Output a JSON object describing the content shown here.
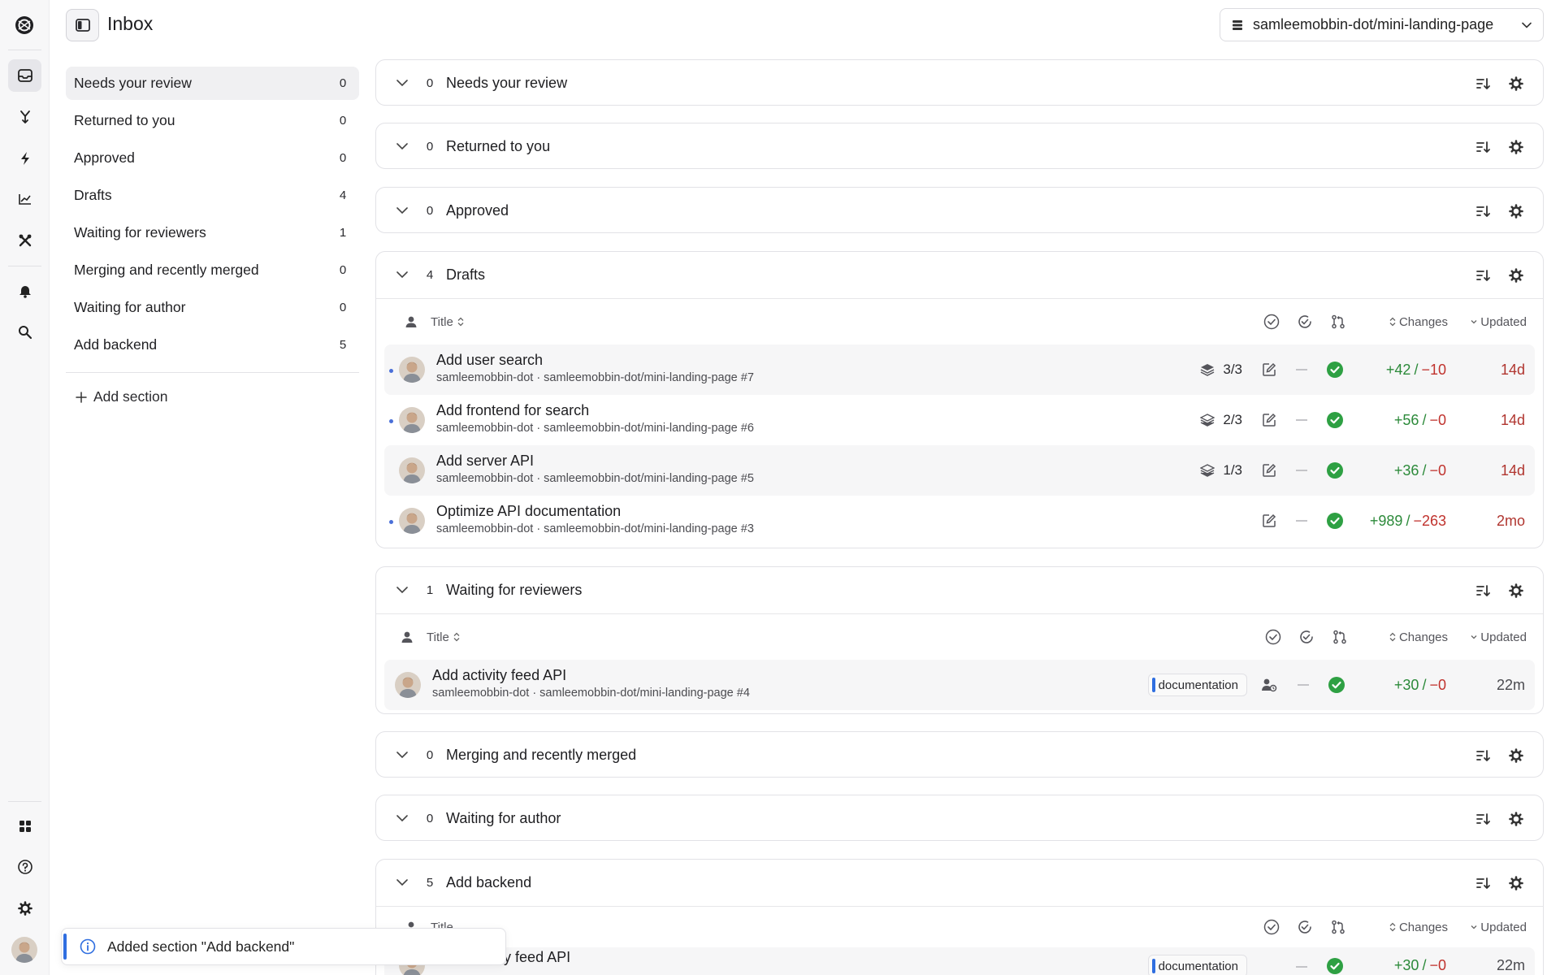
{
  "header": {
    "title": "Inbox",
    "repo": "samleemobbin-dot/mini-landing-page"
  },
  "colors": {
    "accent": "#2f6ee0",
    "additions": "#2c8a3a",
    "deletions": "#c0322d",
    "stale": "#b0352f",
    "check": "#2ea043"
  },
  "nav": {
    "items": [
      {
        "label": "Needs your review",
        "count": "0"
      },
      {
        "label": "Returned to you",
        "count": "0"
      },
      {
        "label": "Approved",
        "count": "0"
      },
      {
        "label": "Drafts",
        "count": "4"
      },
      {
        "label": "Waiting for reviewers",
        "count": "1"
      },
      {
        "label": "Merging and recently merged",
        "count": "0"
      },
      {
        "label": "Waiting for author",
        "count": "0"
      },
      {
        "label": "Add backend",
        "count": "5"
      }
    ],
    "add_section": "Add section"
  },
  "columns": {
    "title": "Title",
    "changes": "Changes",
    "updated": "Updated"
  },
  "sections": {
    "needs_review": {
      "count": "0",
      "title": "Needs your review"
    },
    "returned": {
      "count": "0",
      "title": "Returned to you"
    },
    "approved": {
      "count": "0",
      "title": "Approved"
    },
    "drafts": {
      "count": "4",
      "title": "Drafts",
      "rows": [
        {
          "title": "Add user search",
          "sub": "samleemobbin-dot · samleemobbin-dot/mini-landing-page #7",
          "stack": "3/3",
          "add": "+42",
          "del": "−10",
          "updated": "14d"
        },
        {
          "title": "Add frontend for search",
          "sub": "samleemobbin-dot · samleemobbin-dot/mini-landing-page #6",
          "stack": "2/3",
          "add": "+56",
          "del": "−0",
          "updated": "14d"
        },
        {
          "title": "Add server API",
          "sub": "samleemobbin-dot · samleemobbin-dot/mini-landing-page #5",
          "stack": "1/3",
          "add": "+36",
          "del": "−0",
          "updated": "14d"
        },
        {
          "title": "Optimize API documentation",
          "sub": "samleemobbin-dot · samleemobbin-dot/mini-landing-page #3",
          "add": "+989",
          "del": "−263",
          "updated": "2mo"
        }
      ]
    },
    "waiting_reviewers": {
      "count": "1",
      "title": "Waiting for reviewers",
      "rows": [
        {
          "title": "Add activity feed API",
          "sub": "samleemobbin-dot · samleemobbin-dot/mini-landing-page #4",
          "tag": "documentation",
          "add": "+30",
          "del": "−0",
          "updated": "22m"
        }
      ]
    },
    "merging": {
      "count": "0",
      "title": "Merging and recently merged"
    },
    "waiting_author": {
      "count": "0",
      "title": "Waiting for author"
    },
    "add_backend": {
      "count": "5",
      "title": "Add backend",
      "rows": [
        {
          "title": "Add activity feed API",
          "tag": "documentation",
          "add": "+30",
          "del": "−0",
          "updated": "22m"
        }
      ]
    }
  },
  "toast": {
    "message": "Added section \"Add backend\""
  },
  "icons": {
    "rail": [
      "logo-icon",
      "inbox-icon",
      "merge-icon",
      "bolt-icon",
      "chart-icon",
      "tools-icon",
      "bell-icon",
      "search-icon",
      "apps-icon",
      "help-icon",
      "settings-icon"
    ],
    "section": [
      "sort-icon",
      "gear-icon",
      "chevron-down-icon"
    ]
  }
}
